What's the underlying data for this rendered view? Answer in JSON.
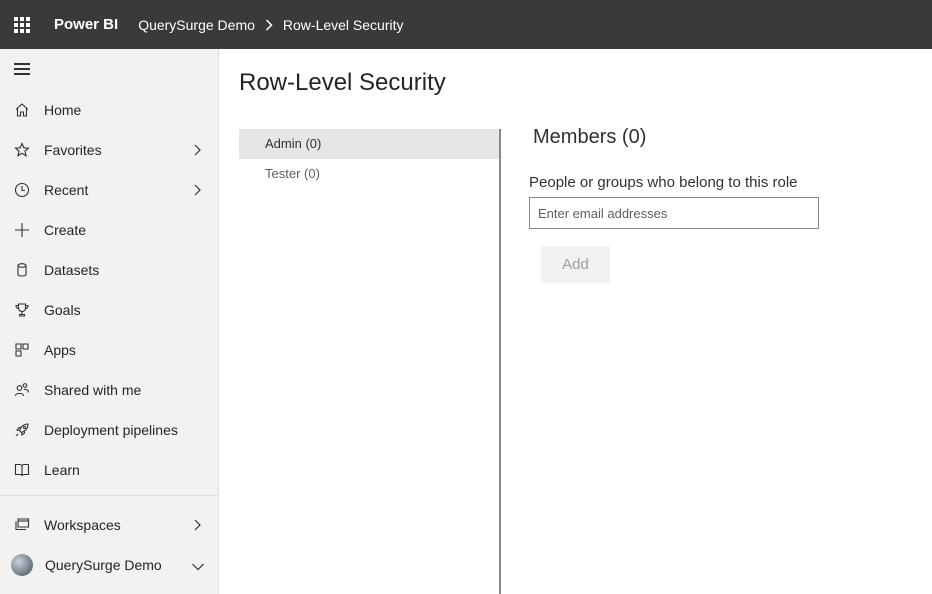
{
  "topbar": {
    "brand": "Power BI",
    "breadcrumb": [
      "QuerySurge Demo",
      "Row-Level Security"
    ]
  },
  "sidebar": {
    "items": [
      {
        "label": "Home",
        "icon": "home-icon"
      },
      {
        "label": "Favorites",
        "icon": "star-icon",
        "chevron": "right"
      },
      {
        "label": "Recent",
        "icon": "clock-icon",
        "chevron": "right"
      },
      {
        "label": "Create",
        "icon": "plus-icon"
      },
      {
        "label": "Datasets",
        "icon": "database-icon"
      },
      {
        "label": "Goals",
        "icon": "trophy-icon"
      },
      {
        "label": "Apps",
        "icon": "apps-icon"
      },
      {
        "label": "Shared with me",
        "icon": "shared-people-icon"
      },
      {
        "label": "Deployment pipelines",
        "icon": "rocket-icon"
      },
      {
        "label": "Learn",
        "icon": "book-icon"
      }
    ],
    "bottom": [
      {
        "label": "Workspaces",
        "icon": "workspaces-icon",
        "chevron": "right"
      },
      {
        "label": "QuerySurge Demo",
        "icon": "workspace-avatar",
        "chevron": "down"
      }
    ]
  },
  "main": {
    "title": "Row-Level Security",
    "roles": [
      {
        "label": "Admin (0)",
        "selected": true
      },
      {
        "label": "Tester (0)",
        "selected": false
      }
    ],
    "members": {
      "title": "Members (0)",
      "label": "People or groups who belong to this role",
      "input_placeholder": "Enter email addresses",
      "input_value": "",
      "add_label": "Add"
    }
  },
  "colors": {
    "topbar": "#3b3a39",
    "sidebar": "#f3f2f1",
    "selected_role": "#e6e6e6"
  }
}
